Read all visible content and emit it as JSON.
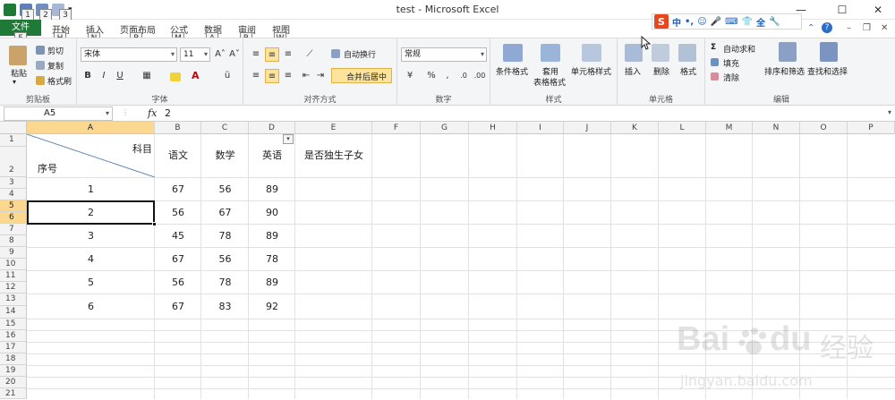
{
  "window": {
    "title": "test - Microsoft Excel",
    "minimize": "—",
    "maximize": "☐",
    "close": "✕"
  },
  "quick_access": {
    "keytips": [
      "1",
      "2",
      "3"
    ]
  },
  "ime": {
    "logo": "S",
    "items": [
      "中",
      "•,",
      "☺",
      "🎤",
      "⌨",
      "👕",
      "全",
      "🔧"
    ]
  },
  "tabs": [
    {
      "label": "文件",
      "keytip": "F"
    },
    {
      "label": "开始",
      "keytip": "H"
    },
    {
      "label": "插入",
      "keytip": "N"
    },
    {
      "label": "页面布局",
      "keytip": "P"
    },
    {
      "label": "公式",
      "keytip": "M"
    },
    {
      "label": "数据",
      "keytip": "A"
    },
    {
      "label": "审阅",
      "keytip": "R"
    },
    {
      "label": "视图",
      "keytip": "W"
    }
  ],
  "ribbon": {
    "clipboard": {
      "label": "剪贴板",
      "paste": "粘贴",
      "cut": "剪切",
      "copy": "复制",
      "format_painter": "格式刷"
    },
    "font": {
      "label": "字体",
      "name": "宋体",
      "size": "11",
      "bold": "B",
      "italic": "I",
      "underline": "U"
    },
    "alignment": {
      "label": "对齐方式",
      "wrap": "自动换行",
      "merge": "合并后居中"
    },
    "number": {
      "label": "数字",
      "format": "常规"
    },
    "styles": {
      "label": "样式",
      "conditional": "条件格式",
      "table_line1": "套用",
      "table_line2": "表格格式",
      "cell_styles": "单元格样式"
    },
    "cells": {
      "label": "单元格",
      "insert": "插入",
      "delete": "删除",
      "format": "格式"
    },
    "editing": {
      "label": "编辑",
      "autosum": "自动求和",
      "fill": "填充",
      "clear": "清除",
      "sort": "排序和筛选",
      "find": "查找和选择"
    }
  },
  "formula_bar": {
    "name_box": "A5",
    "fx": "fx",
    "value": "2"
  },
  "columns": [
    "A",
    "B",
    "C",
    "D",
    "E",
    "F",
    "G",
    "H",
    "I",
    "J",
    "K",
    "L",
    "M",
    "N",
    "O",
    "P"
  ],
  "rows": [
    "1",
    "2",
    "3",
    "4",
    "5",
    "6",
    "7",
    "8",
    "9",
    "10",
    "11",
    "12",
    "13",
    "14",
    "15",
    "16",
    "17",
    "18",
    "19",
    "20",
    "21"
  ],
  "sheet": {
    "header_subject": "科目",
    "header_number": "序号",
    "headers": [
      "语文",
      "数学",
      "英语",
      "是否独生子女"
    ],
    "records": [
      {
        "id": "1",
        "chinese": "67",
        "math": "56",
        "english": "89"
      },
      {
        "id": "2",
        "chinese": "56",
        "math": "67",
        "english": "90"
      },
      {
        "id": "3",
        "chinese": "45",
        "math": "78",
        "english": "89"
      },
      {
        "id": "4",
        "chinese": "67",
        "math": "56",
        "english": "78"
      },
      {
        "id": "5",
        "chinese": "56",
        "math": "78",
        "english": "89"
      },
      {
        "id": "6",
        "chinese": "67",
        "math": "83",
        "english": "92"
      }
    ]
  },
  "watermark": {
    "brand": "Bai",
    "brand2": "du",
    "cn": "经验",
    "url": "jingyan.baidu.com"
  }
}
